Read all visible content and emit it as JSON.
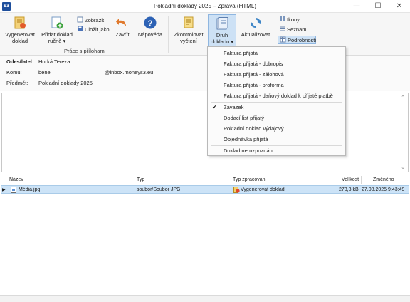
{
  "window": {
    "app_icon": "S3",
    "title": "Pokladní doklady 2025 – Zpráva (HTML)",
    "minimize": "—",
    "maximize": "☐",
    "close": "✕"
  },
  "ribbon": {
    "generate_label_1": "Vygenerovat",
    "generate_label_2": "doklad",
    "add_label_1": "Přidat doklad",
    "add_label_2": "ručně ▾",
    "show_label": "Zobrazit",
    "save_as_label": "Uložit jako",
    "close_label": "Zavřít",
    "help_label": "Nápověda",
    "attachments_group": "Práce s přílohami",
    "check_label_1": "Zkontrolovat",
    "check_label_2": "vyčtení",
    "doctype_label_1": "Druh",
    "doctype_label_2": "dokladu ▾",
    "refresh_label": "Aktualizovat",
    "view_icons": "Ikony",
    "view_list": "Seznam",
    "view_details": "Podrobnosti"
  },
  "header": {
    "from_label": "Odesílatel:",
    "from_value": "Horká Tereza",
    "to_label": "Komu:",
    "to_value_1": "bene_",
    "to_value_2": "@inbox.moneys3.eu",
    "subject_label": "Předmět:",
    "subject_value": "Pokladní doklady 2025"
  },
  "grid": {
    "columns": [
      "Název",
      "Typ",
      "Typ zpracování",
      "Velikost",
      "Změněno"
    ],
    "rows": [
      {
        "name": "Média.jpg",
        "type": "soubor/Soubor JPG",
        "processing": "Vygenerovat doklad",
        "size": "273,3 kB",
        "modified": "27.08.2025 9:43:49"
      }
    ]
  },
  "menu": {
    "items": [
      "Faktura přijatá",
      "Faktura přijatá - dobropis",
      "Faktura přijatá - zálohová",
      "Faktura přijatá - proforma",
      "Faktura přijatá - daňový doklad k přijaté platbě",
      "Závazek",
      "Dodací list přijatý",
      "Pokladní doklad výdajový",
      "Objednávka přijatá",
      "Doklad nerozpoznán"
    ],
    "checked": "Závazek",
    "check_glyph": "✔"
  },
  "colors": {
    "selection": "#cce3f7",
    "menu_bg": "#fbfbfb",
    "accent": "#1e4f9c"
  }
}
